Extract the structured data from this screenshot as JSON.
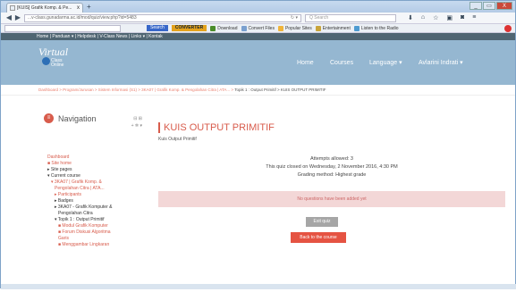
{
  "browser": {
    "tab_title": "[KUIS] Grafik Komp. & Pe...",
    "tab_close": "x",
    "new_tab": "+",
    "url": "...v-class.gunadarma.ac.id/mod/quiz/view.php?id=5483",
    "search_placeholder": "Q Search",
    "window_controls": [
      "_",
      "▭",
      "X"
    ]
  },
  "toolbar": {
    "search_label": "Search",
    "converter_label": "CONVERTER",
    "items": [
      {
        "label": "Download",
        "color": "#4a8c2a"
      },
      {
        "label": "Convert Files",
        "color": "#7aa0cf"
      },
      {
        "label": "Popular Sites",
        "color": "#f0b43a"
      },
      {
        "label": "Entertainment",
        "color": "#c9a43a"
      },
      {
        "label": "Listen to the Radio",
        "color": "#4e9bd1"
      }
    ]
  },
  "site": {
    "linkbar": "Home | Panduan ▾ | Helpdesk | V-Class News | Links ▾ | Kontak",
    "logo_title": "Virtual",
    "logo_sub1": "Class",
    "logo_sub2": "Online",
    "nav_home": "Home",
    "nav_courses": "Courses",
    "nav_language": "Language ▾",
    "nav_user": "Avlarini Indrati ▾"
  },
  "breadcrumb": {
    "path": "Dashboard > Program/Jurusan > Sistem Informasi (S1) > 3KA07 | Grafik Komp. & Pengolahan Citra | ATA... > ",
    "current": "Topik 1 : Output Primitif > KUIS OUTPUT PRIMITIF"
  },
  "navigation": {
    "title": "Navigation",
    "controls": "⊟ ⊞",
    "controls2": "+ ✲ ▾",
    "items": [
      {
        "label": "Dashboard",
        "level": 1,
        "red": true
      },
      {
        "label": "■ Site home",
        "level": 1,
        "red": true
      },
      {
        "label": "▸ Site pages",
        "level": 1,
        "red": false
      },
      {
        "label": "▾ Current course",
        "level": 1,
        "red": false
      },
      {
        "label": "▾ 3KA07 | Grafik Komp. &",
        "level": 2,
        "red": true
      },
      {
        "label": "Pengolahan Citra | ATA...",
        "level": 3,
        "red": true
      },
      {
        "label": "▸ Participants",
        "level": 3,
        "red": true
      },
      {
        "label": "▸ Badges",
        "level": 3,
        "red": false
      },
      {
        "label": "▸ 3KA07 - Grafik Komputer &",
        "level": 3,
        "red": false
      },
      {
        "label": "Pengolahan Citra",
        "level": 4,
        "red": false
      },
      {
        "label": "▾ Topik 1 : Output Primitif",
        "level": 3,
        "red": false
      },
      {
        "label": "■ Modul Grafik Komputer",
        "level": 4,
        "red": true
      },
      {
        "label": "■ Forum Diskusi Algoritma",
        "level": 4,
        "red": true
      },
      {
        "label": "Garis",
        "level": 4,
        "red": true
      },
      {
        "label": "■ Menggambar Lingkaran",
        "level": 4,
        "red": true
      }
    ]
  },
  "quiz": {
    "title": "KUIS OUTPUT PRIMITIF",
    "subtitle": "Kuis Output Primitif",
    "attempts": "Attempts allowed: 3",
    "closed": "This quiz closed on Wednesday, 2 November 2016, 4:30 PM",
    "grading": "Grading method: Highest grade",
    "alert": "No questions have been added yet",
    "exit_button": "Exit quiz",
    "back_button": "Back to the course"
  }
}
